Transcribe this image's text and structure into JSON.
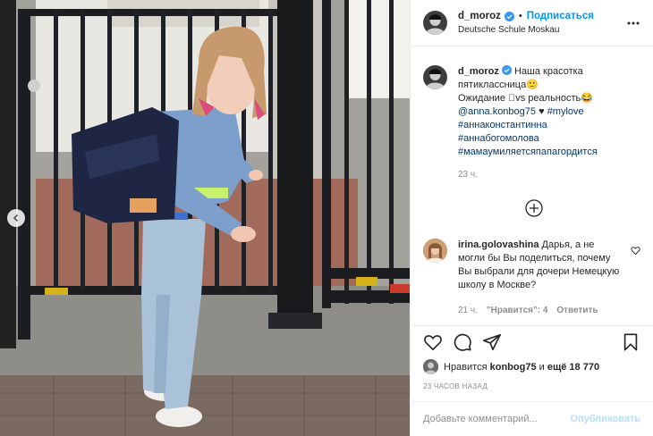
{
  "post": {
    "author": "d_moroz",
    "follow_label": "Подписаться",
    "location": "Deutsche Schule Moskau",
    "caption": {
      "author": "d_moroz",
      "line1": "Наша красотка пятиклассница",
      "line2": "Ожидание ⃞vs реальность",
      "mention": "@anna.konbog75",
      "heart": "♥",
      "tags": [
        "#mylove",
        "#аннаконстантинна",
        "#аннабогомолова",
        "#мамаумиляетсяпапагордится"
      ],
      "time": "23 ч."
    }
  },
  "comment": {
    "author": "irina.golovashina",
    "text": "Дарья, а не могли бы Вы поделиться, почему Вы выбрали для дочери Немецкую школу в Москве?",
    "time": "21 ч.",
    "likes": "\"Нравится\": 4",
    "reply": "Ответить"
  },
  "likes": {
    "prefix": "Нравится",
    "user": "konbog75",
    "middle": "и",
    "others": "ещё 18 770"
  },
  "posted": "23 ЧАСОВ НАЗАД",
  "add_comment": {
    "placeholder": "Добавьте комментарий...",
    "publish": "Опубликовать"
  },
  "colors": {
    "accent": "#0095f6",
    "link": "#00376b",
    "muted": "#8e8e8e",
    "publish_disabled": "#b2dffc"
  }
}
